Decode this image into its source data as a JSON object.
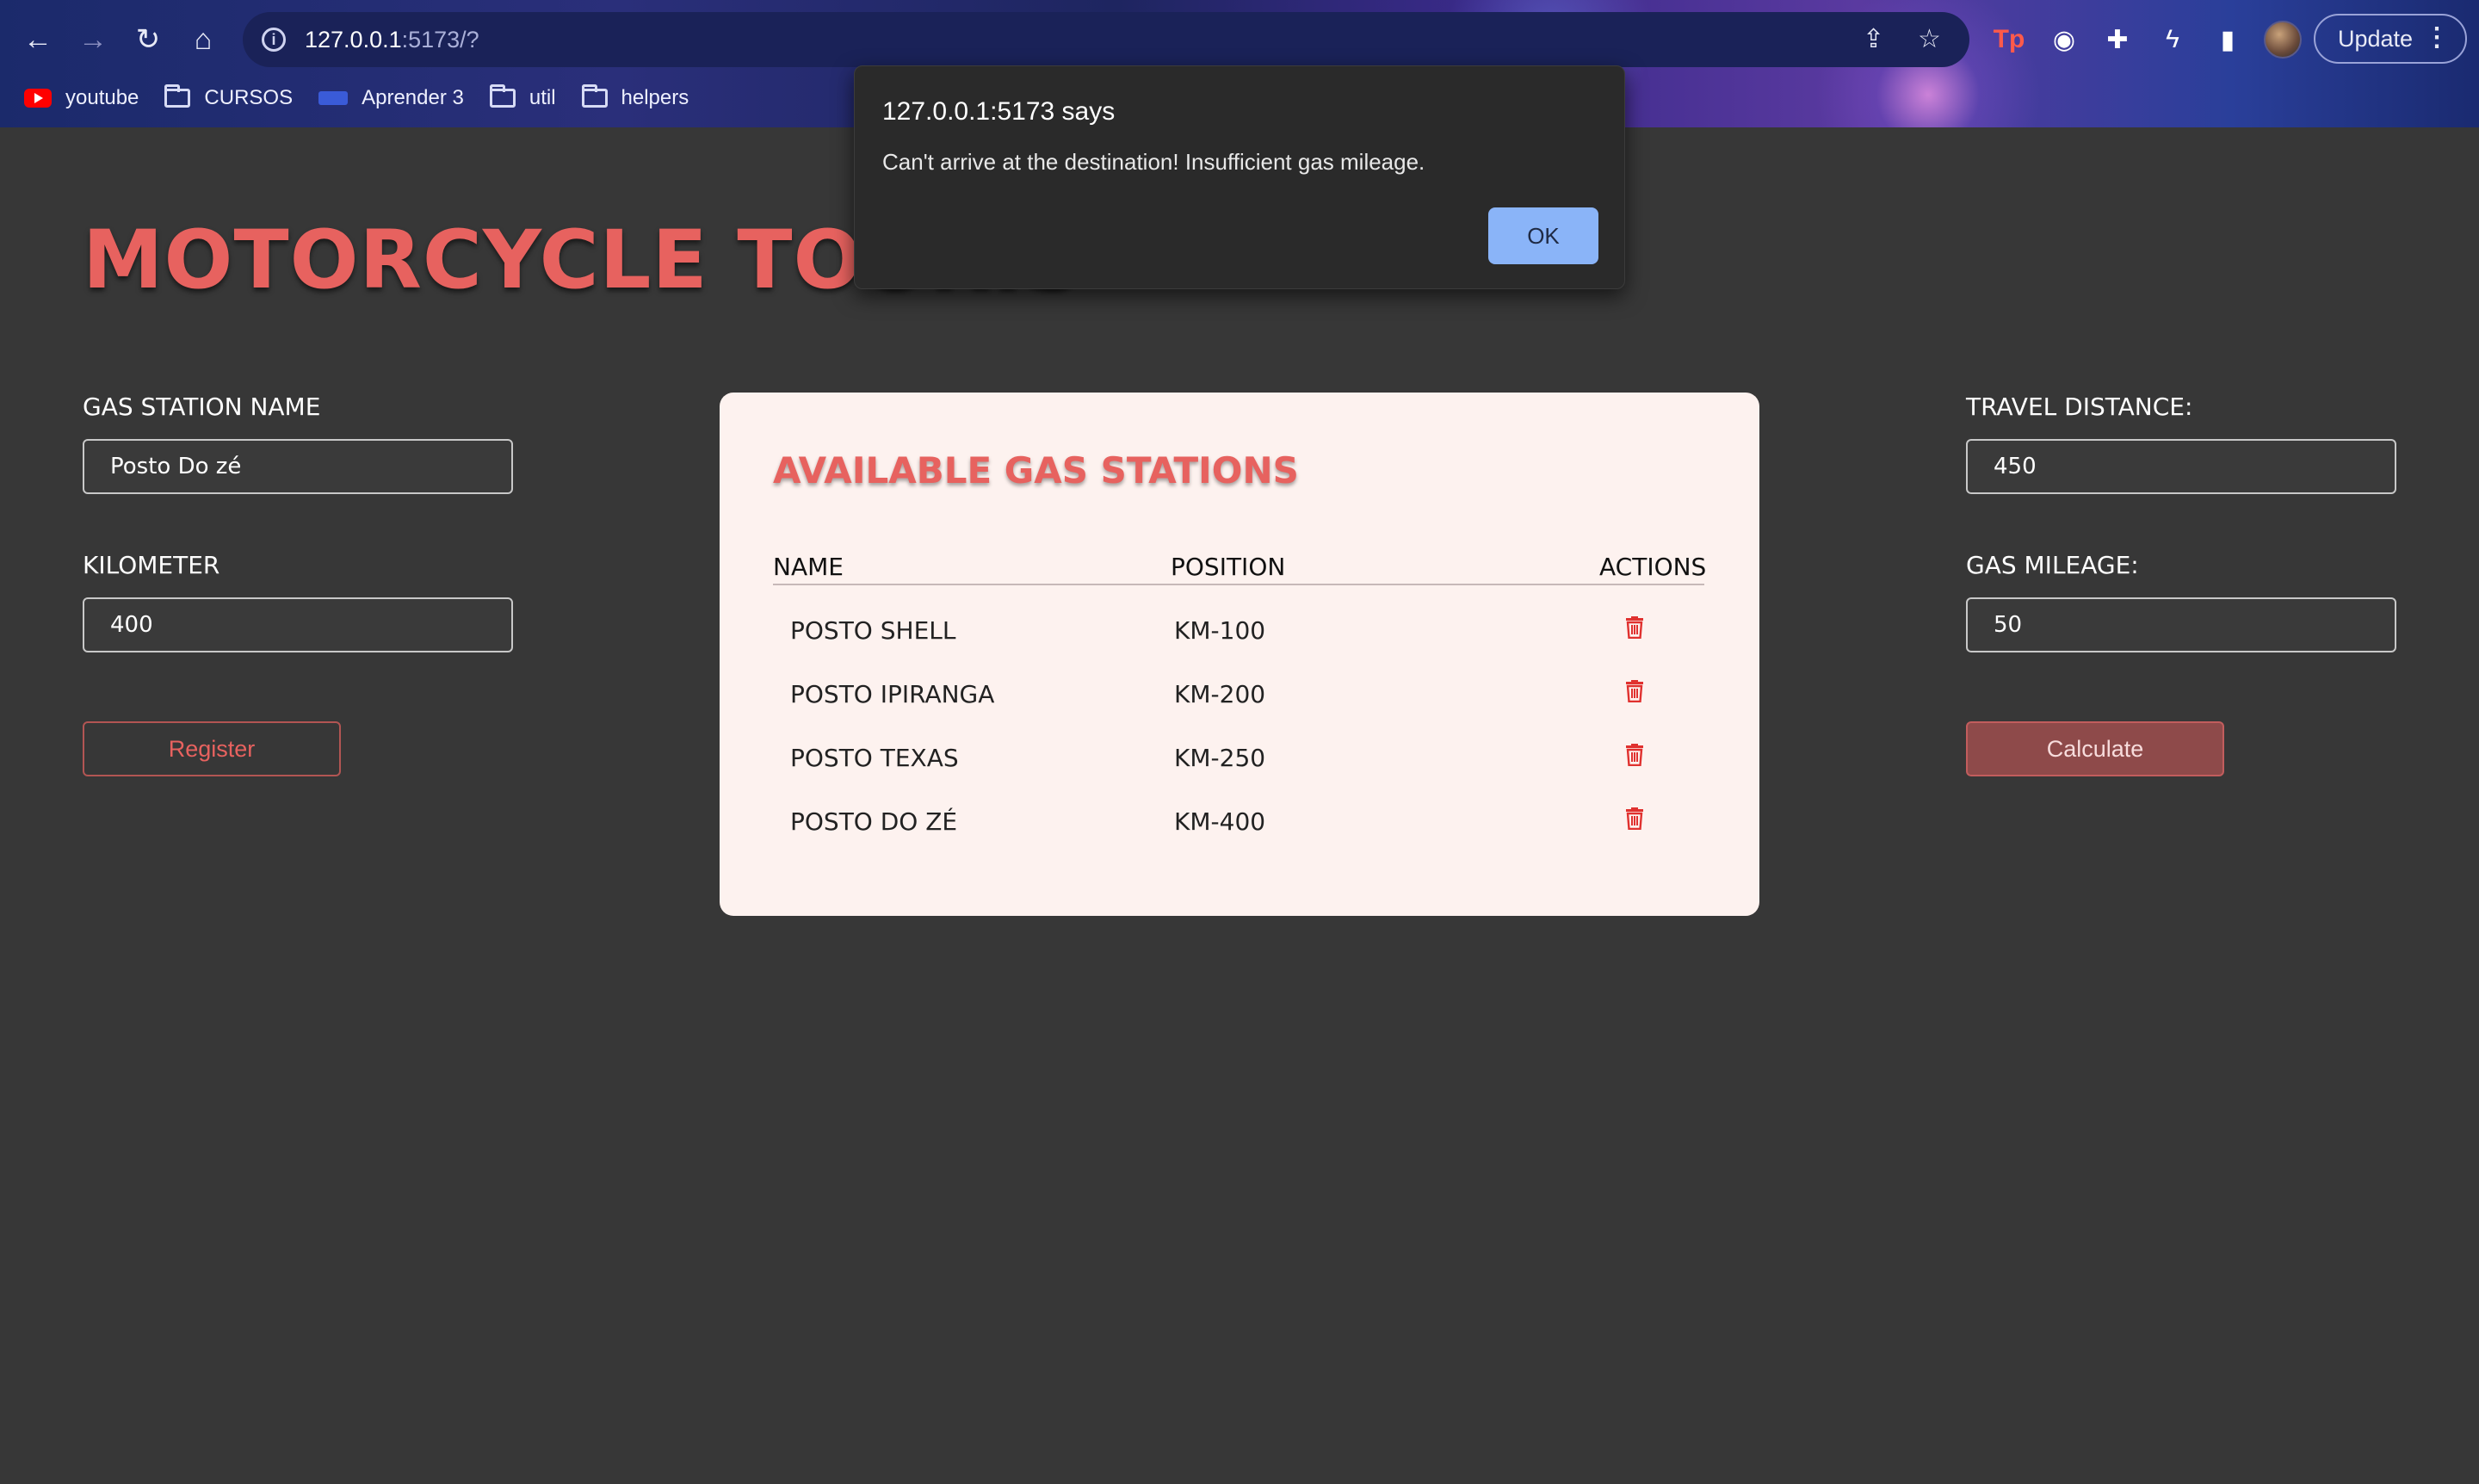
{
  "browser": {
    "url_host": "127.0.0.1",
    "url_rest": ":5173/?",
    "update_label": "Update",
    "bookmarks": [
      {
        "label": "youtube",
        "icon": "youtube-icon"
      },
      {
        "label": "CURSOS",
        "icon": "folder-icon"
      },
      {
        "label": "Aprender 3",
        "icon": "globe-icon"
      },
      {
        "label": "util",
        "icon": "folder-icon"
      },
      {
        "label": "helpers",
        "icon": "folder-icon"
      }
    ]
  },
  "page": {
    "title": "MOTORCYCLE TOURIS",
    "register_form": {
      "name_label": "GAS STATION NAME",
      "name_value": "Posto Do zé",
      "km_label": "KILOMETER",
      "km_value": "400",
      "register_button": "Register"
    },
    "calc_form": {
      "distance_label": "TRAVEL DISTANCE:",
      "distance_value": "450",
      "mileage_label": "GAS MILEAGE:",
      "mileage_value": "50",
      "calculate_button": "Calculate"
    },
    "stations": {
      "title": "AVAILABLE GAS STATIONS",
      "columns": [
        "NAME",
        "POSITION",
        "ACTIONS"
      ],
      "rows": [
        {
          "name": "POSTO SHELL",
          "position": "KM-100"
        },
        {
          "name": "POSTO IPIRANGA",
          "position": "KM-200"
        },
        {
          "name": "POSTO TEXAS",
          "position": "KM-250"
        },
        {
          "name": "POSTO DO ZÉ",
          "position": "KM-400"
        }
      ]
    }
  },
  "dialog": {
    "title": "127.0.0.1:5173 says",
    "message": "Can't arrive at the destination! Insufficient gas mileage.",
    "ok_label": "OK"
  },
  "colors": {
    "accent": "#e7625f",
    "background": "#373737",
    "card": "#fdf2ef",
    "dialog_button": "#8ab4f8"
  }
}
